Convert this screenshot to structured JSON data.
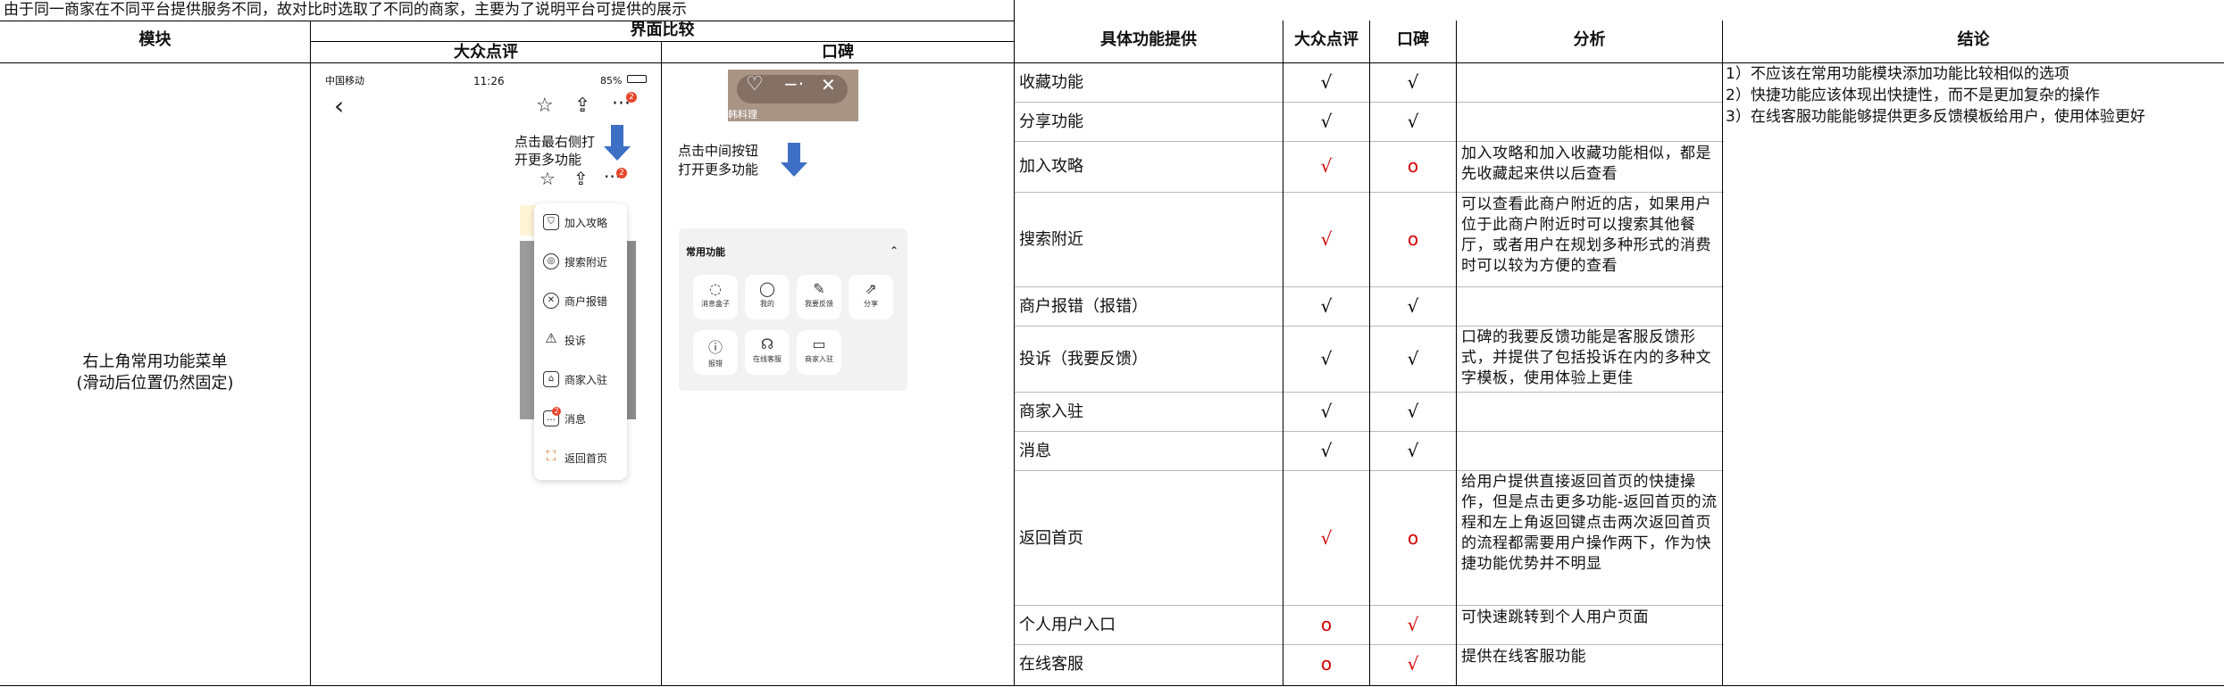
{
  "note": "由于同一商家在不同平台提供服务不同，故对比时选取了不同的商家，主要为了说明平台可提供的展示",
  "left_table": {
    "col_module": "模块",
    "col_compare": "界面比较",
    "sub_dianping": "大众点评",
    "sub_koubei": "口碑",
    "module_line1": "右上角常用功能菜单",
    "module_line2": "(滑动后位置仍然固定)"
  },
  "dianping_phone": {
    "carrier": "中国移动",
    "time": "11:26",
    "battery": "85%",
    "badge": "2",
    "hint_line1": "点击最右侧打",
    "hint_line2": "开更多功能",
    "menu": [
      {
        "label": "加入攻略",
        "icon": "shield-icon"
      },
      {
        "label": "搜索附近",
        "icon": "location-icon"
      },
      {
        "label": "商户报错",
        "icon": "error-icon"
      },
      {
        "label": "投诉",
        "icon": "warning-icon"
      },
      {
        "label": "商家入驻",
        "icon": "store-icon"
      },
      {
        "label": "消息",
        "icon": "message-icon"
      },
      {
        "label": "返回首页",
        "icon": "home-icon"
      }
    ]
  },
  "koubei_phone": {
    "banner_text": "韩料理",
    "hint_line1": "点击中间按钮",
    "hint_line2": "打开更多功能",
    "panel_title": "常用功能",
    "tiles": [
      "消息盒子",
      "我的",
      "我要反馈",
      "分享",
      "报错",
      "在线客服",
      "商家入驻"
    ]
  },
  "right_table": {
    "headers": [
      "具体功能提供",
      "大众点评",
      "口碑",
      "分析",
      "结论"
    ],
    "rows": [
      {
        "name": "收藏功能",
        "dp": "√",
        "kb": "√",
        "dp_red": false,
        "kb_red": false,
        "analysis": ""
      },
      {
        "name": "分享功能",
        "dp": "√",
        "kb": "√",
        "dp_red": false,
        "kb_red": false,
        "analysis": ""
      },
      {
        "name": "加入攻略",
        "dp": "√",
        "kb": "o",
        "dp_red": true,
        "kb_red": true,
        "analysis": "加入攻略和加入收藏功能相似，都是先收藏起来供以后查看"
      },
      {
        "name": "搜索附近",
        "dp": "√",
        "kb": "o",
        "dp_red": true,
        "kb_red": true,
        "analysis": "可以查看此商户附近的店，如果用户位于此商户附近时可以搜索其他餐厅，或者用户在规划多种形式的消费时可以较为方便的查看"
      },
      {
        "name": "商户报错（报错）",
        "dp": "√",
        "kb": "√",
        "dp_red": false,
        "kb_red": false,
        "analysis": ""
      },
      {
        "name": "投诉（我要反馈）",
        "dp": "√",
        "kb": "√",
        "dp_red": false,
        "kb_red": false,
        "analysis": "口碑的我要反馈功能是客服反馈形式，并提供了包括投诉在内的多种文字模板，使用体验上更佳"
      },
      {
        "name": "商家入驻",
        "dp": "√",
        "kb": "√",
        "dp_red": false,
        "kb_red": false,
        "analysis": ""
      },
      {
        "name": "消息",
        "dp": "√",
        "kb": "√",
        "dp_red": false,
        "kb_red": false,
        "analysis": ""
      },
      {
        "name": "返回首页",
        "dp": "√",
        "kb": "o",
        "dp_red": true,
        "kb_red": true,
        "analysis": "给用户提供直接返回首页的快捷操作，但是点击更多功能-返回首页的流程和左上角返回键点击两次返回首页的流程都需要用户操作两下，作为快捷功能优势并不明显"
      },
      {
        "name": "个人用户入口",
        "dp": "o",
        "kb": "√",
        "dp_red": true,
        "kb_red": true,
        "analysis": "可快速跳转到个人用户页面"
      },
      {
        "name": "在线客服",
        "dp": "o",
        "kb": "√",
        "dp_red": true,
        "kb_red": true,
        "analysis": "提供在线客服功能"
      }
    ],
    "conclusions": [
      "1）不应该在常用功能模块添加功能比较相似的选项",
      "2）快捷功能应该体现出快捷性，而不是更加复杂的操作",
      "3）在线客服功能能够提供更多反馈模板给用户，使用体验更好"
    ]
  }
}
